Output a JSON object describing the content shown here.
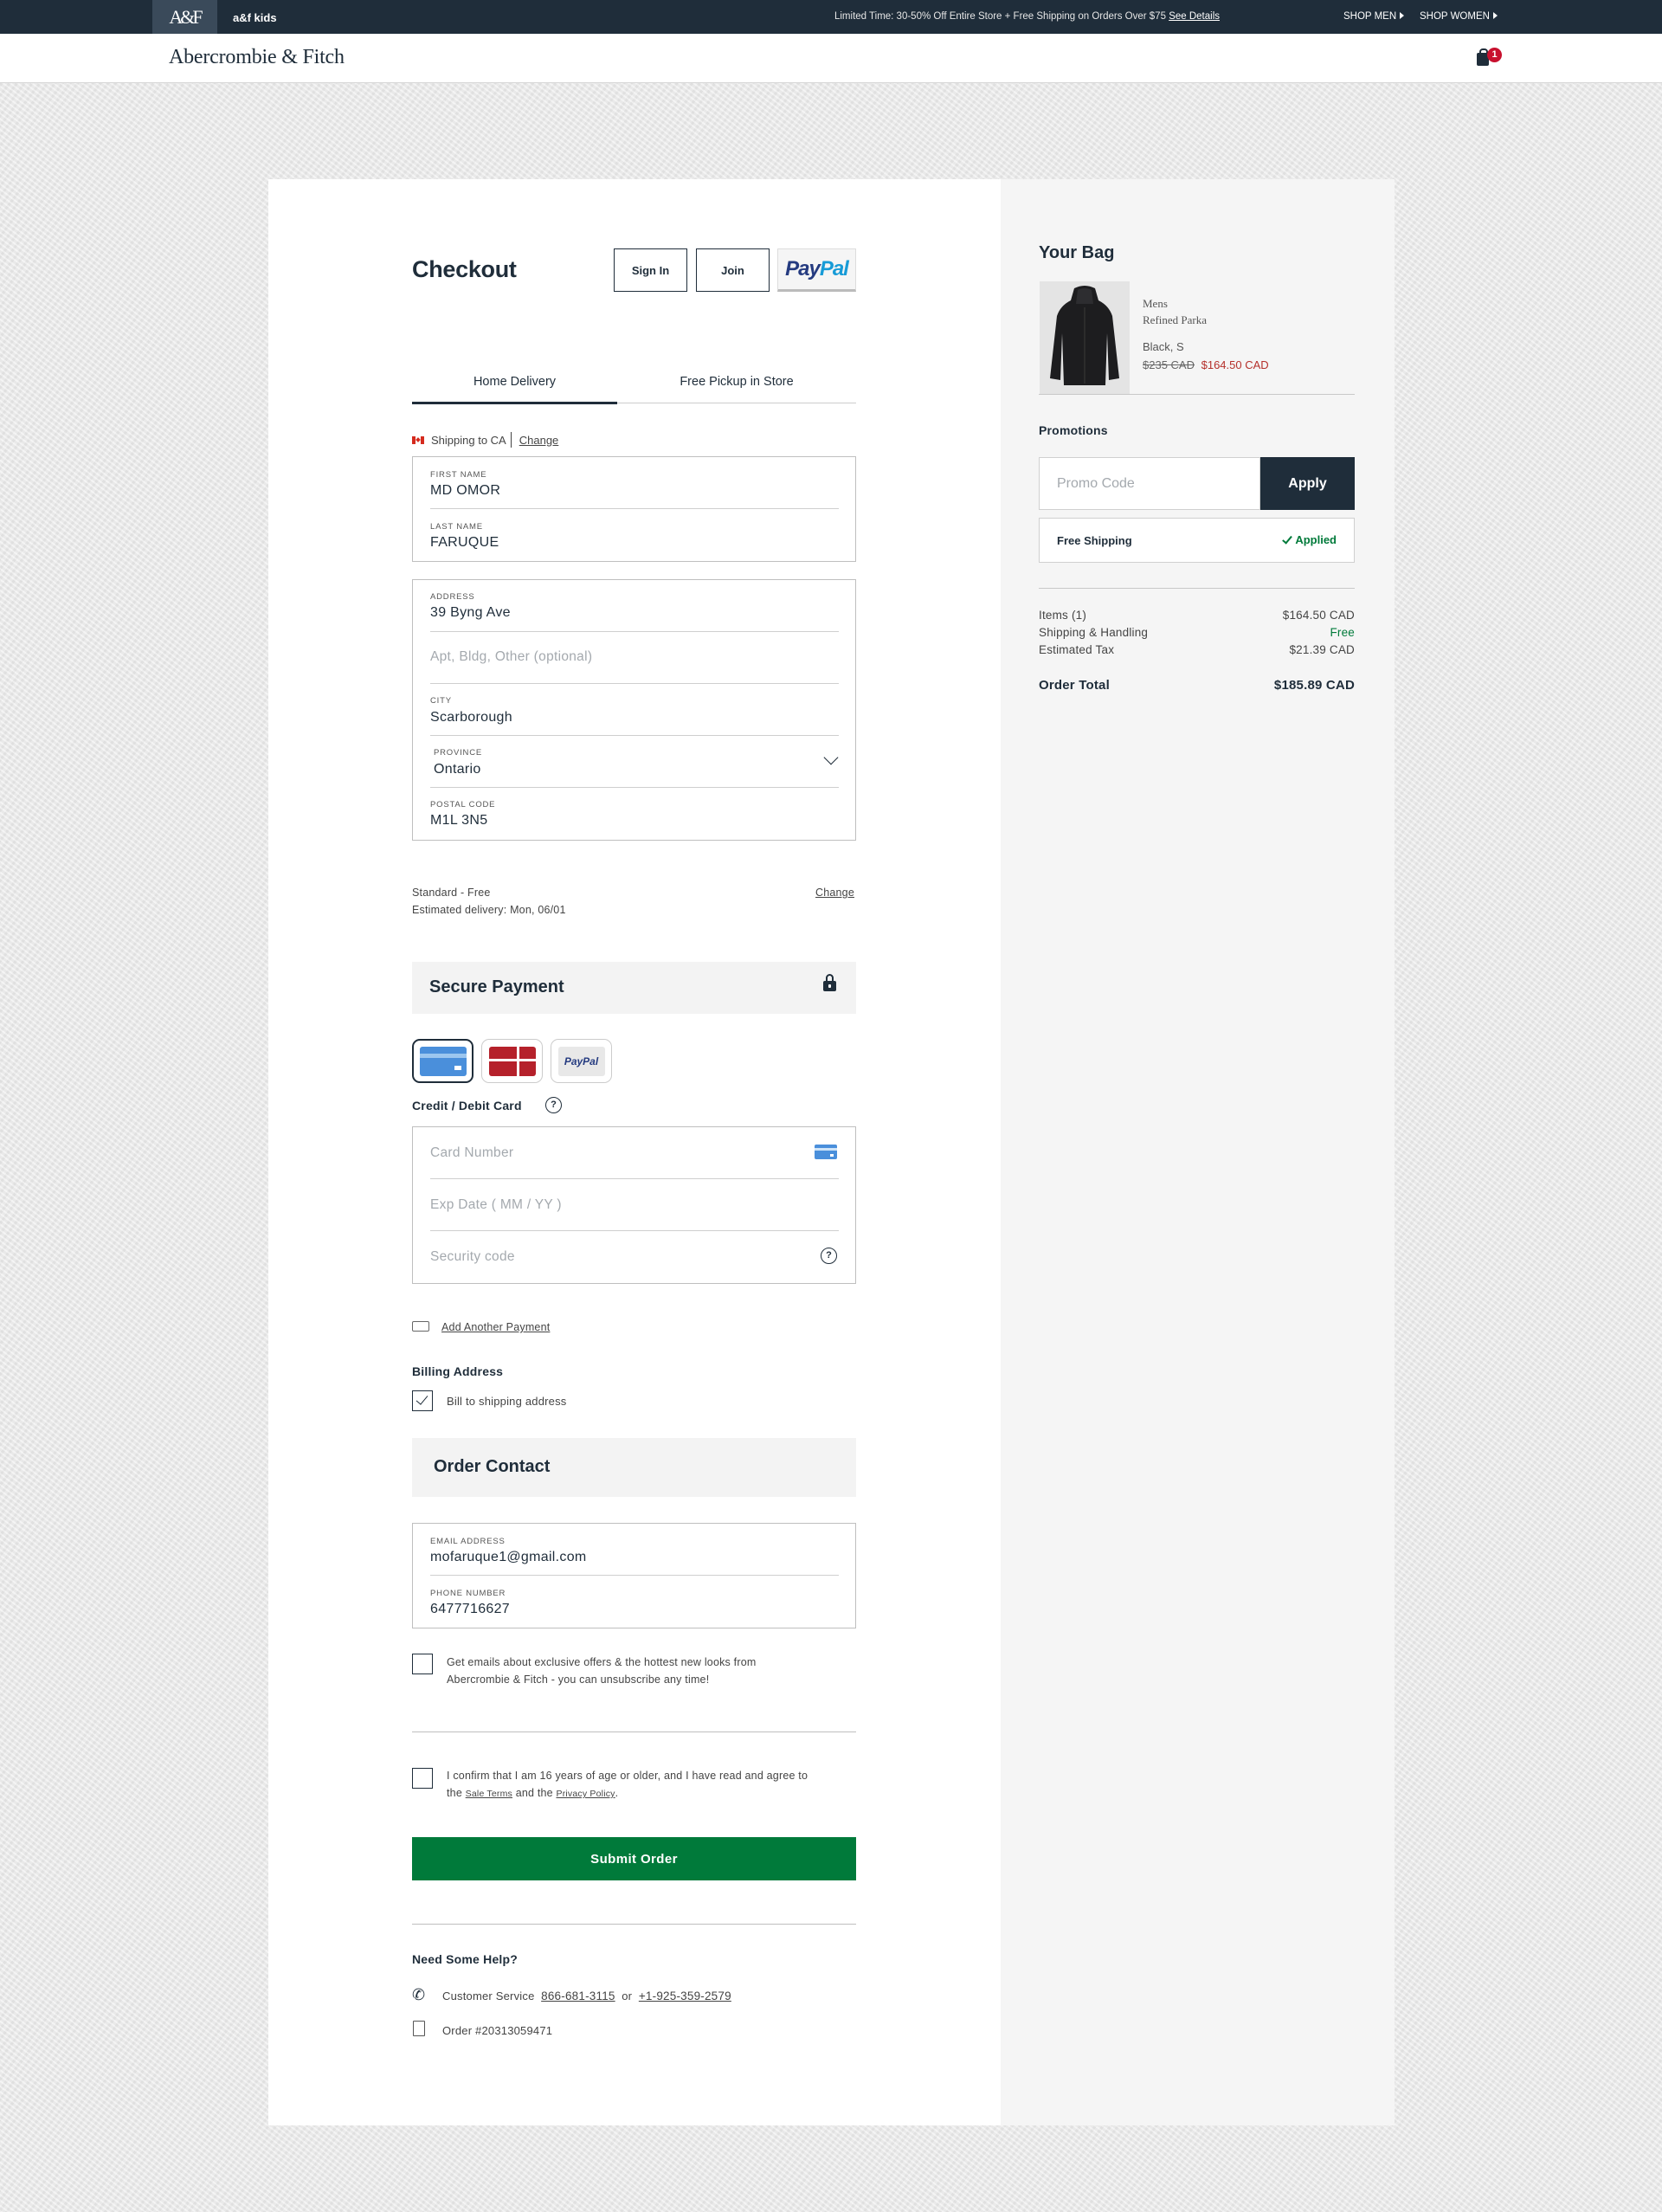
{
  "promo_bar": {
    "kids_logo": "A&F",
    "kids_label": "a&f kids",
    "message": "Limited Time: 30-50% Off Entire Store + Free Shipping on Orders Over $75",
    "see_details": "See Details",
    "shop_men": "SHOP MEN",
    "shop_women": "SHOP WOMEN"
  },
  "header": {
    "brand": "Abercrombie & Fitch",
    "bag_count": "1"
  },
  "checkout": {
    "title": "Checkout",
    "sign_in": "Sign In",
    "join": "Join",
    "paypal_pay": "Pay",
    "paypal_pal": "Pal"
  },
  "tabs": {
    "home_delivery": "Home Delivery",
    "store_pickup": "Free Pickup in Store"
  },
  "shipping": {
    "ship_to": "Shipping to CA",
    "change": "Change",
    "first_name_label": "FIRST NAME",
    "first_name": "MD OMOR",
    "last_name_label": "LAST NAME",
    "last_name": "FARUQUE",
    "address_label": "ADDRESS",
    "address": "39 Byng Ave",
    "apt_placeholder": "Apt, Bldg, Other (optional)",
    "city_label": "CITY",
    "city": "Scarborough",
    "province_label": "PROVINCE",
    "province": "Ontario",
    "postal_label": "POSTAL CODE",
    "postal": "M1L 3N5"
  },
  "delivery": {
    "method": "Standard - Free",
    "estimate": "Estimated delivery:  Mon, 06/01",
    "change": "Change"
  },
  "payment": {
    "title": "Secure Payment",
    "paypal_mini": "PayPal",
    "card_heading": "Credit / Debit Card",
    "help": "?",
    "card_number_placeholder": "Card Number",
    "exp_placeholder": "Exp Date ( MM / YY )",
    "cvv_placeholder": "Security code",
    "add_payment": "Add Another Payment"
  },
  "billing": {
    "heading": "Billing Address",
    "bill_to_shipping": "Bill to shipping address"
  },
  "contact": {
    "title": "Order Contact",
    "email_label": "EMAIL ADDRESS",
    "email": "mofaruque1@gmail.com",
    "phone_label": "PHONE NUMBER",
    "phone": "6477716627"
  },
  "consents": {
    "emails_line1": "Get emails about exclusive offers & the hottest new looks from",
    "emails_line2": "Abercrombie & Fitch - you can unsubscribe any time!",
    "age_line1": "I confirm that I am 16 years of age or older, and I have read and agree to",
    "age_pre": "the",
    "sale_terms": "Sale Terms",
    "and_the": "and the",
    "privacy": "Privacy Policy",
    "period": "."
  },
  "submit": "Submit Order",
  "help": {
    "heading": "Need Some Help?",
    "customer_service": "Customer Service",
    "phone1": "866-681-3115",
    "or": "or",
    "phone2": "+1-925-359-2579",
    "order_number": "Order #20313059471"
  },
  "bag": {
    "title": "Your Bag",
    "item": {
      "category": "Mens",
      "name": "Refined Parka",
      "variant": "Black, S",
      "orig_price": "$235 CAD",
      "sale_price": "$164.50 CAD"
    }
  },
  "promotions": {
    "heading": "Promotions",
    "placeholder": "Promo Code",
    "apply": "Apply",
    "free_shipping": "Free Shipping",
    "applied": "Applied"
  },
  "summary": {
    "items_label": "Items (1)",
    "items_value": "$164.50 CAD",
    "shipping_label": "Shipping & Handling",
    "shipping_value": "Free",
    "tax_label": "Estimated Tax",
    "tax_value": "$21.39 CAD",
    "total_label": "Order Total",
    "total_value": "$185.89 CAD"
  },
  "colors": {
    "navy": "#1f2d3a",
    "green": "#007a3a",
    "sale_red": "#b5302b"
  }
}
